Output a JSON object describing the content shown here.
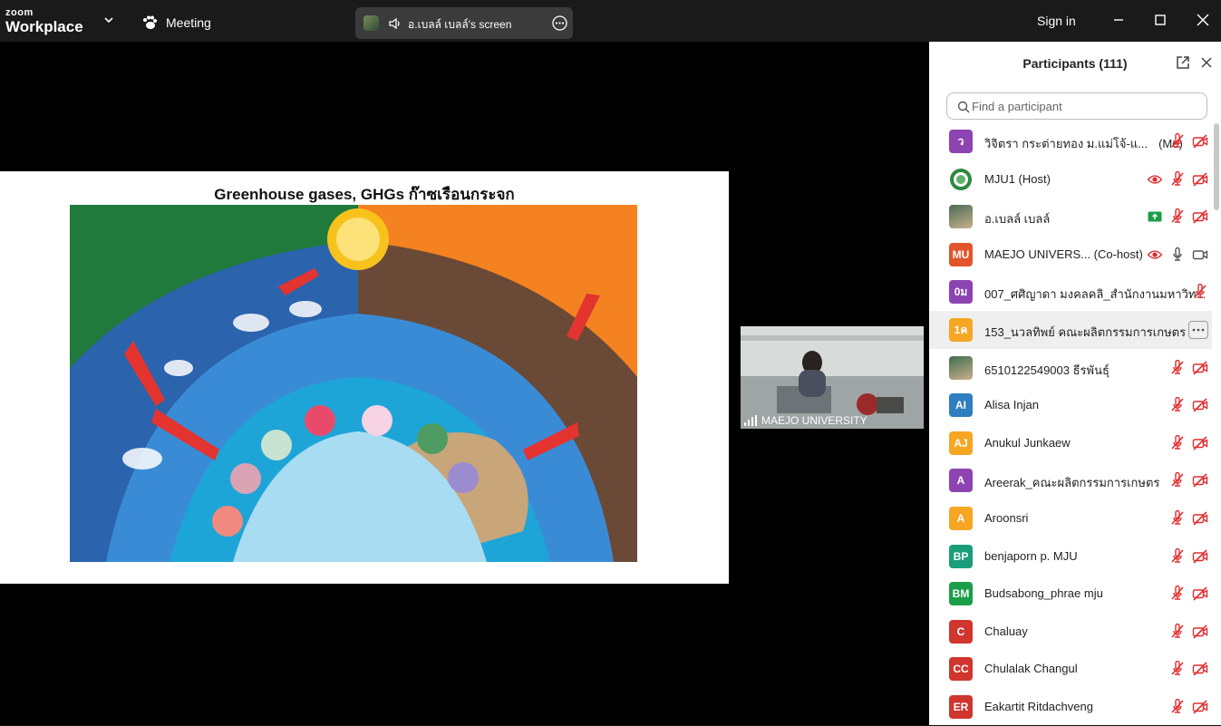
{
  "app": {
    "brand_top": "zoom",
    "brand_bottom": "Workplace",
    "meeting_label": "Meeting",
    "sign_in": "Sign in"
  },
  "share": {
    "label": "อ.เบลล์ เบลล์'s screen"
  },
  "slide": {
    "title": "Greenhouse gases, GHGs ก๊าซเรือนกระจก"
  },
  "video": {
    "name": "MAEJO UNIVERSITY"
  },
  "panel": {
    "title": "Participants (111)",
    "search_placeholder": "Find a participant"
  },
  "colors": {
    "accent_red": "#e02d2d",
    "share_green": "#1a9e48",
    "natural_green": "#1f7a3c",
    "enhanced_orange": "#f58220"
  },
  "participants": [
    {
      "initials": "ว",
      "name": "วิจิตรา กระต่ายทอง ม.แม่โจ้-แ...",
      "tag": "(Me)",
      "color": "#8d44b2",
      "icons": [
        "mic-off-icon",
        "video-off-icon"
      ]
    },
    {
      "initials": "",
      "name": "MJU1 (Host)",
      "tag": "",
      "color": "#2d8a3e",
      "logo": true,
      "icons": [
        "recording-icon",
        "mic-off-icon",
        "video-off-icon"
      ]
    },
    {
      "initials": "",
      "name": "อ.เบลล์ เบลล์",
      "tag": "",
      "color": "#4b6b55",
      "photo": true,
      "icons": [
        "share-screen-icon",
        "mic-off-icon",
        "video-off-icon"
      ]
    },
    {
      "initials": "MU",
      "name": "MAEJO UNIVERS... (Co-host)",
      "tag": "",
      "color": "#e0552b",
      "icons": [
        "recording-icon",
        "mic-on-icon",
        "video-on-icon"
      ]
    },
    {
      "initials": "0ม",
      "name": "007_ศศิญาดา มงคลคลิ_สำนักงานมหาวิท...",
      "tag": "",
      "color": "#8d44b2",
      "icons": [
        "mic-off-icon"
      ]
    },
    {
      "initials": "1ค",
      "name": "153_นวลทิพย์ คณะผลิตกรรมการเกษตร",
      "tag": "",
      "color": "#f5a623",
      "hover": true,
      "icons": [
        "more-icon"
      ]
    },
    {
      "initials": "",
      "name": "6510122549003 ธีรพันธุ์",
      "tag": "",
      "color": "#3f6e4e",
      "photo": true,
      "icons": [
        "mic-off-icon",
        "video-off-icon"
      ]
    },
    {
      "initials": "AI",
      "name": "Alisa Injan",
      "tag": "",
      "color": "#2f7ec0",
      "icons": [
        "mic-off-icon",
        "video-off-icon"
      ]
    },
    {
      "initials": "AJ",
      "name": "Anukul Junkaew",
      "tag": "",
      "color": "#f5a623",
      "icons": [
        "mic-off-icon",
        "video-off-icon"
      ]
    },
    {
      "initials": "A",
      "name": "Areerak_คณะผลิตกรรมการเกษตร",
      "tag": "",
      "color": "#8d44b2",
      "icons": [
        "mic-off-icon",
        "video-off-icon"
      ]
    },
    {
      "initials": "A",
      "name": "Aroonsri",
      "tag": "",
      "color": "#f5a623",
      "icons": [
        "mic-off-icon",
        "video-off-icon"
      ]
    },
    {
      "initials": "BP",
      "name": "benjaporn p. MJU",
      "tag": "",
      "color": "#1a9e7a",
      "icons": [
        "mic-off-icon",
        "video-off-icon"
      ]
    },
    {
      "initials": "BM",
      "name": "Budsabong_phrae mju",
      "tag": "",
      "color": "#1a9e48",
      "icons": [
        "mic-off-icon",
        "video-off-icon"
      ]
    },
    {
      "initials": "C",
      "name": "Chaluay",
      "tag": "",
      "color": "#d0352e",
      "icons": [
        "mic-off-icon",
        "video-off-icon"
      ]
    },
    {
      "initials": "CC",
      "name": "Chulalak Changul",
      "tag": "",
      "color": "#d0352e",
      "icons": [
        "mic-off-icon",
        "video-off-icon"
      ]
    },
    {
      "initials": "ER",
      "name": "Eakartit Ritdachveng",
      "tag": "",
      "color": "#d0352e",
      "icons": [
        "mic-off-icon",
        "video-off-icon"
      ]
    }
  ]
}
